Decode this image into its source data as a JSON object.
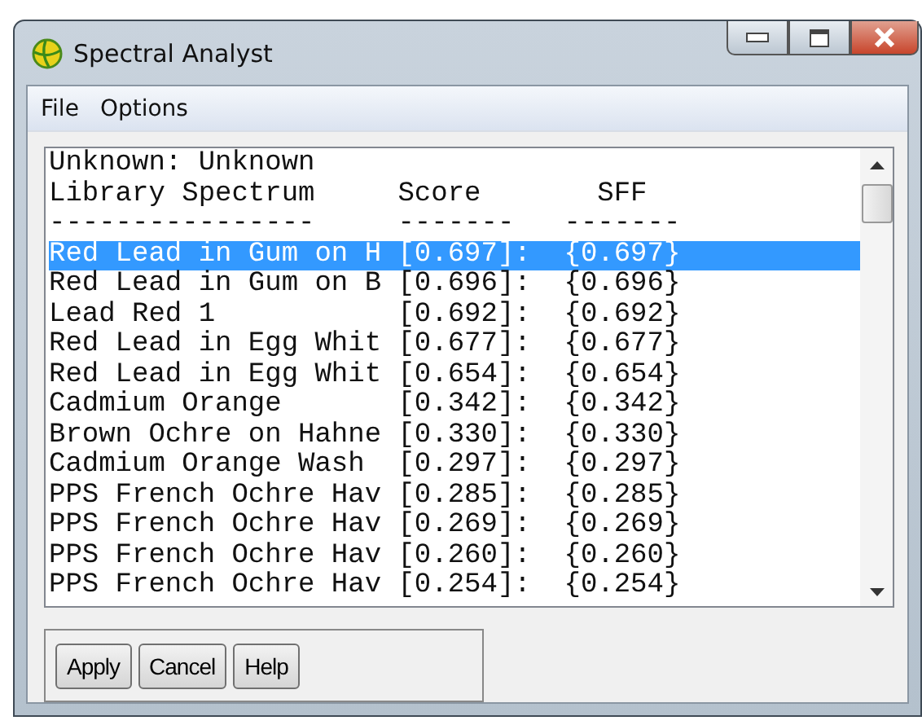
{
  "window": {
    "title": "Spectral Analyst"
  },
  "menu": [
    "File",
    "Options"
  ],
  "unknown_line": "Unknown: Unknown",
  "columns": [
    {
      "label": "Library Spectrum",
      "rule": "----------------"
    },
    {
      "label": "Score",
      "rule": "-------"
    },
    {
      "label": "SFF",
      "rule": "-------"
    }
  ],
  "rows": [
    {
      "name": "Red Lead in Gum on H",
      "score": "[0.697]:",
      "sff": "{0.697}",
      "selected": true
    },
    {
      "name": "Red Lead in Gum on B",
      "score": "[0.696]:",
      "sff": "{0.696}",
      "selected": false
    },
    {
      "name": "Lead Red 1",
      "score": "[0.692]:",
      "sff": "{0.692}",
      "selected": false
    },
    {
      "name": "Red Lead in Egg Whit",
      "score": "[0.677]:",
      "sff": "{0.677}",
      "selected": false
    },
    {
      "name": "Red Lead in Egg Whit",
      "score": "[0.654]:",
      "sff": "{0.654}",
      "selected": false
    },
    {
      "name": "Cadmium Orange",
      "score": "[0.342]:",
      "sff": "{0.342}",
      "selected": false
    },
    {
      "name": "Brown Ochre on Hahne",
      "score": "[0.330]:",
      "sff": "{0.330}",
      "selected": false
    },
    {
      "name": "Cadmium Orange Wash",
      "score": "[0.297]:",
      "sff": "{0.297}",
      "selected": false
    },
    {
      "name": "PPS French Ochre Hav",
      "score": "[0.285]:",
      "sff": "{0.285}",
      "selected": false
    },
    {
      "name": "PPS French Ochre Hav",
      "score": "[0.269]:",
      "sff": "{0.269}",
      "selected": false
    },
    {
      "name": "PPS French Ochre Hav",
      "score": "[0.260]:",
      "sff": "{0.260}",
      "selected": false
    },
    {
      "name": "PPS French Ochre Hav",
      "score": "[0.254]:",
      "sff": "{0.254}",
      "selected": false
    }
  ],
  "buttons": [
    "Apply",
    "Cancel",
    "Help"
  ]
}
